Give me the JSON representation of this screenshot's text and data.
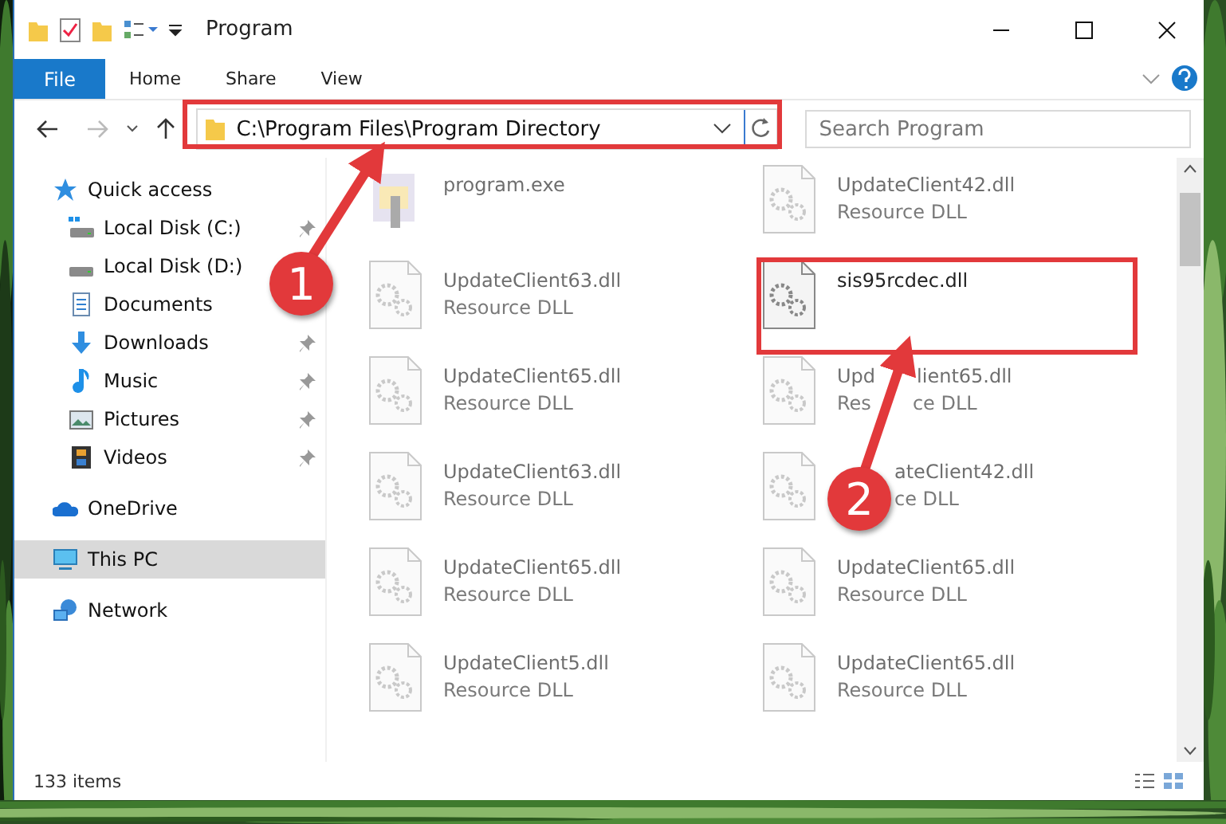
{
  "window": {
    "title": "Program"
  },
  "ribbon": {
    "file_button": "File",
    "tabs": [
      "Home",
      "Share",
      "View"
    ]
  },
  "address": "C:\\Program Files\\Program Directory",
  "search": {
    "placeholder": "Search Program"
  },
  "sidebar": {
    "items": [
      {
        "label": "Quick access",
        "kind": "star",
        "selected": false,
        "children": [
          {
            "label": "Local Disk (C:)",
            "kind": "drive_c",
            "pinned": true,
            "selected": false
          },
          {
            "label": "Local Disk (D:)",
            "kind": "drive",
            "pinned": false,
            "selected": false
          },
          {
            "label": "Documents",
            "kind": "document",
            "pinned": false,
            "selected": false
          },
          {
            "label": "Downloads",
            "kind": "download",
            "pinned": true,
            "selected": false
          },
          {
            "label": "Music",
            "kind": "music",
            "pinned": true,
            "selected": false
          },
          {
            "label": "Pictures",
            "kind": "pictures",
            "pinned": true,
            "selected": false
          },
          {
            "label": "Videos",
            "kind": "videos",
            "pinned": true,
            "selected": false
          }
        ]
      },
      {
        "label": "OneDrive",
        "kind": "cloud",
        "selected": false
      },
      {
        "label": "This PC",
        "kind": "pc",
        "selected": true
      },
      {
        "label": "Network",
        "kind": "network",
        "selected": false
      }
    ]
  },
  "files": [
    {
      "name": "program.exe",
      "kind": "exe",
      "dimmed": true
    },
    {
      "name": "UpdateClient42.dll",
      "type": "Resource DLL",
      "kind": "dll",
      "dimmed": true
    },
    {
      "name": "UpdateClient63.dll",
      "type": "Resource DLL",
      "kind": "dll",
      "dimmed": true
    },
    {
      "name": "sis95rcdec.dll",
      "kind": "dll",
      "dimmed": false
    },
    {
      "name": "UpdateClient65.dll",
      "type": "Resource DLL",
      "kind": "dll",
      "dimmed": true
    },
    {
      "name": [
        "Upd",
        "lient65.dll"
      ],
      "type": [
        "Res",
        "ce DLL"
      ],
      "kind": "dll",
      "dimmed": true
    },
    {
      "name": "UpdateClient63.dll",
      "type": "Resource DLL",
      "kind": "dll",
      "dimmed": true
    },
    {
      "name": "ateClient42.dll",
      "type": "ce DLL",
      "kind": "dll",
      "dimmed": true,
      "cut_left": true
    },
    {
      "name": "UpdateClient65.dll",
      "type": "Resource DLL",
      "kind": "dll",
      "dimmed": true
    },
    {
      "name": "UpdateClient65.dll",
      "type": "Resource DLL",
      "kind": "dll",
      "dimmed": true
    },
    {
      "name": "UpdateClient5.dll",
      "type": "Resource DLL",
      "kind": "dll",
      "dimmed": true
    },
    {
      "name": "UpdateClient65.dll",
      "type": "Resource DLL",
      "kind": "dll",
      "dimmed": true
    }
  ],
  "status_bar": {
    "count": "133 items"
  },
  "annotations": [
    {
      "label": "1"
    },
    {
      "label": "2"
    }
  ]
}
